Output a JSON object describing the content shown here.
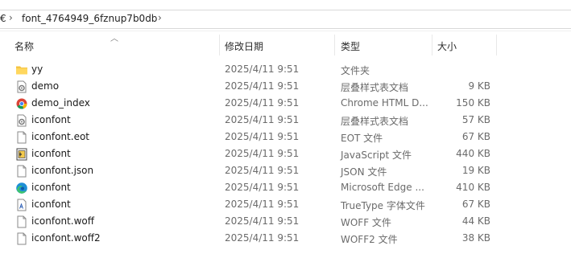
{
  "address": {
    "prev_fragment": "€",
    "current_folder": "font_4764949_6fznup7b0db"
  },
  "columns": {
    "name": "名称",
    "modified": "修改日期",
    "type": "类型",
    "size": "大小"
  },
  "files": [
    {
      "name": "yy",
      "modified": "2025/4/11 9:51",
      "type": "文件夹",
      "size": "",
      "icon": "folder-icon"
    },
    {
      "name": "demo",
      "modified": "2025/4/11 9:51",
      "type": "层叠样式表文档",
      "size": "9 KB",
      "icon": "css-gear-icon"
    },
    {
      "name": "demo_index",
      "modified": "2025/4/11 9:51",
      "type": "Chrome HTML D...",
      "size": "150 KB",
      "icon": "chrome-icon"
    },
    {
      "name": "iconfont",
      "modified": "2025/4/11 9:51",
      "type": "层叠样式表文档",
      "size": "57 KB",
      "icon": "css-gear-icon"
    },
    {
      "name": "iconfont.eot",
      "modified": "2025/4/11 9:51",
      "type": "EOT 文件",
      "size": "67 KB",
      "icon": "blank-file-icon"
    },
    {
      "name": "iconfont",
      "modified": "2025/4/11 9:51",
      "type": "JavaScript 文件",
      "size": "440 KB",
      "icon": "js-file-icon"
    },
    {
      "name": "iconfont.json",
      "modified": "2025/4/11 9:51",
      "type": "JSON 文件",
      "size": "19 KB",
      "icon": "blank-file-icon"
    },
    {
      "name": "iconfont",
      "modified": "2025/4/11 9:51",
      "type": "Microsoft Edge ...",
      "size": "410 KB",
      "icon": "edge-icon"
    },
    {
      "name": "iconfont",
      "modified": "2025/4/11 9:51",
      "type": "TrueType 字体文件",
      "size": "67 KB",
      "icon": "font-file-icon"
    },
    {
      "name": "iconfont.woff",
      "modified": "2025/4/11 9:51",
      "type": "WOFF 文件",
      "size": "44 KB",
      "icon": "blank-file-icon"
    },
    {
      "name": "iconfont.woff2",
      "modified": "2025/4/11 9:51",
      "type": "WOFF2 文件",
      "size": "38 KB",
      "icon": "blank-file-icon"
    }
  ]
}
